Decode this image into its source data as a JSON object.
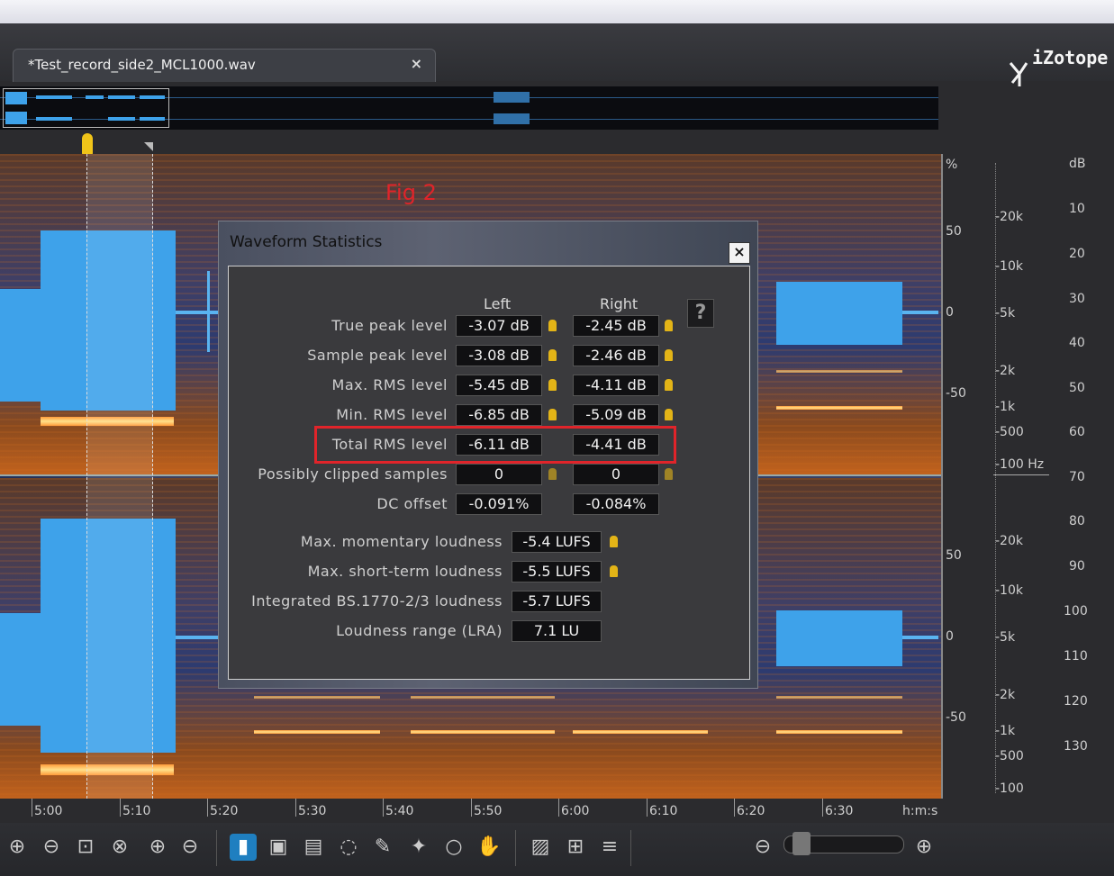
{
  "tab": {
    "title": "*Test_record_side2_MCL1000.wav",
    "close": "×"
  },
  "brand": {
    "name": "iZotope"
  },
  "annotation": {
    "fig_label": "Fig 2"
  },
  "percent_axis": {
    "unit": "%",
    "labels": [
      "50",
      "0",
      "-50",
      "50",
      "0",
      "-50"
    ]
  },
  "freq_axis": {
    "upper": [
      "-20k",
      "-10k",
      "-5k",
      "-2k",
      "-1k",
      "-500",
      "-100 Hz"
    ],
    "lower": [
      "-20k",
      "-10k",
      "-5k",
      "-2k",
      "-1k",
      "-500",
      "-100"
    ]
  },
  "db_axis": {
    "unit": "dB",
    "labels": [
      "10",
      "20",
      "30",
      "40",
      "50",
      "60",
      "70",
      "80",
      "90",
      "100",
      "110",
      "120",
      "130"
    ]
  },
  "timeline": {
    "labels": [
      "5:00",
      "5:10",
      "5:20",
      "5:30",
      "5:40",
      "5:50",
      "6:00",
      "6:10",
      "6:20",
      "6:30"
    ],
    "unit": "h:m:s"
  },
  "dialog": {
    "title": "Waveform Statistics",
    "close": "×",
    "col_left": "Left",
    "col_right": "Right",
    "help": "?",
    "rows": [
      {
        "label": "True peak level",
        "left": "-3.07 dB",
        "right": "-2.45 dB"
      },
      {
        "label": "Sample peak level",
        "left": "-3.08 dB",
        "right": "-2.46 dB"
      },
      {
        "label": "Max. RMS level",
        "left": "-5.45 dB",
        "right": "-4.11 dB"
      },
      {
        "label": "Min. RMS level",
        "left": "-6.85 dB",
        "right": "-5.09 dB"
      },
      {
        "label": "Total RMS level",
        "left": "-6.11 dB",
        "right": "-4.41 dB"
      },
      {
        "label": "Possibly clipped samples",
        "left": "0",
        "right": "0"
      },
      {
        "label": "DC offset",
        "left": "-0.091%",
        "right": "-0.084%"
      }
    ],
    "loudness": [
      {
        "label": "Max. momentary loudness",
        "value": "-5.4 LUFS"
      },
      {
        "label": "Max. short-term loudness",
        "value": "-5.5 LUFS"
      },
      {
        "label": "Integrated BS.1770-2/3 loudness",
        "value": "-5.7 LUFS"
      },
      {
        "label": "Loudness range (LRA)",
        "value": "7.1 LU"
      }
    ]
  },
  "colors": {
    "accent": "#1f7fc0",
    "highlight": "#e0242a",
    "pin": "#e3b417",
    "wave": "#3ea2ea"
  },
  "toolbar_icons": [
    "zoom-in-time-icon",
    "zoom-out-time-icon",
    "zoom-selection-icon",
    "zoom-reset-icon",
    "zoom-in-freq-icon",
    "zoom-out-freq-icon",
    "time-selection-icon",
    "freq-selection-icon",
    "time-freq-selection-icon",
    "lasso-icon",
    "brush-icon",
    "magic-wand-icon",
    "zoom-tool-icon",
    "hand-tool-icon",
    "instant-process-icon",
    "snap-icon",
    "list-icon",
    "zoom-out-icon",
    "zoom-in-icon"
  ]
}
